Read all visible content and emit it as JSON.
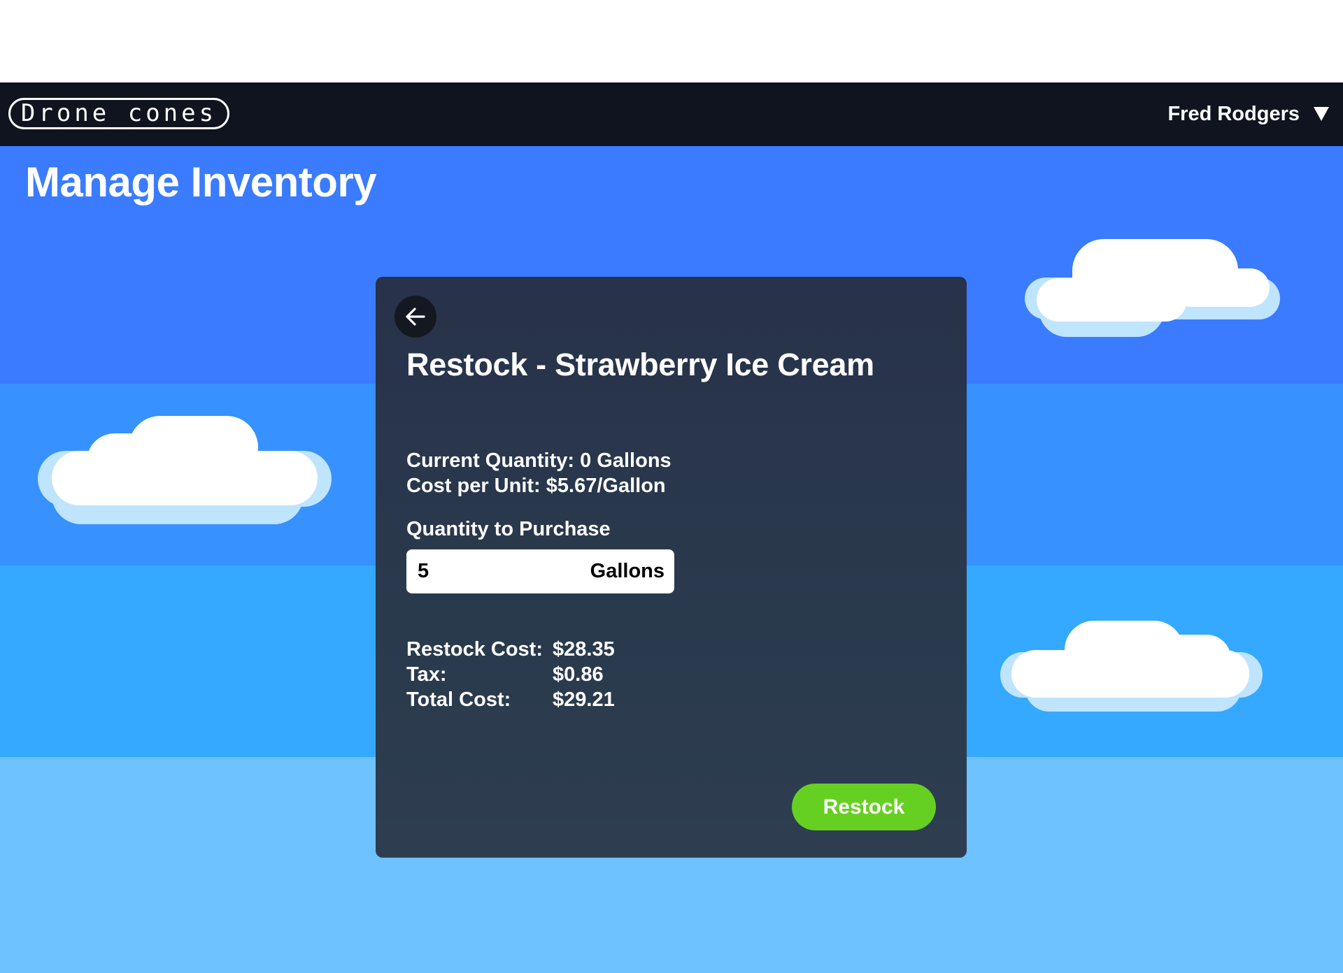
{
  "header": {
    "logo_text": "Drone cones",
    "user_name": "Fred Rodgers",
    "user_menu_icon": "chevron-down-icon"
  },
  "page": {
    "title": "Manage Inventory"
  },
  "modal": {
    "back_icon": "arrow-left-icon",
    "title": "Restock - Strawberry Ice Cream",
    "current_quantity": "Current Quantity: 0 Gallons",
    "cost_per_unit": "Cost per Unit: $5.67/Gallon",
    "quantity_label": "Quantity to Purchase",
    "quantity_value": "5",
    "quantity_unit": "Gallons",
    "costs": [
      {
        "label": "Restock Cost:",
        "value": "$28.35"
      },
      {
        "label": "Tax:",
        "value": "$0.86"
      },
      {
        "label": "Total Cost:",
        "value": "$29.21"
      }
    ],
    "restock_button": "Restock"
  },
  "colors": {
    "navbar": "#10141f",
    "sky_top": "#3a7bff",
    "sky_mid": "#3791ff",
    "sky_low": "#34a9ff",
    "sky_bottom": "#6dc2ff",
    "modal_bg": "#28324a",
    "accent_green": "#65d021"
  }
}
